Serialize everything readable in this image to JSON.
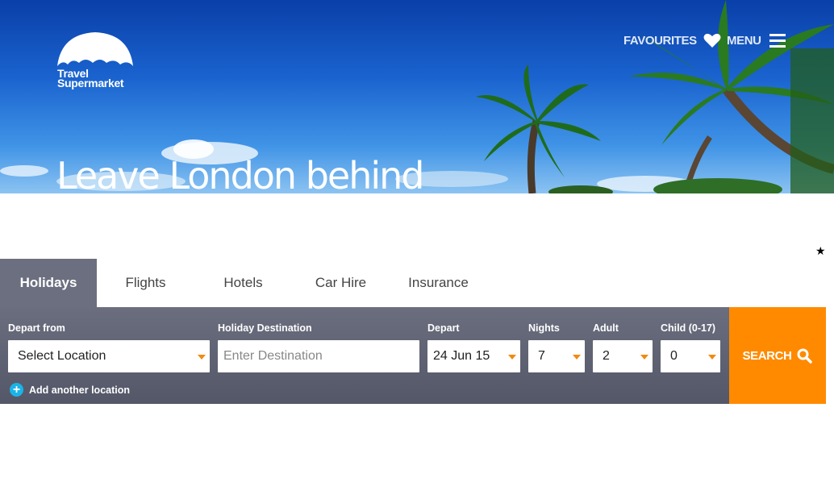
{
  "brand": {
    "logo_line1": "Travel",
    "logo_line2": "Supermarket"
  },
  "nav": {
    "favourites_label": "FAVOURITES",
    "menu_label": "MENU"
  },
  "hero": {
    "title": "Leave London behind"
  },
  "tabs": [
    {
      "label": "Holidays",
      "active": true
    },
    {
      "label": "Flights",
      "active": false
    },
    {
      "label": "Hotels",
      "active": false
    },
    {
      "label": "Car Hire",
      "active": false
    },
    {
      "label": "Insurance",
      "active": false
    }
  ],
  "search": {
    "depart_from": {
      "label": "Depart from",
      "value": "Select Location"
    },
    "destination": {
      "label": "Holiday Destination",
      "placeholder": "Enter Destination"
    },
    "depart": {
      "label": "Depart",
      "value": "24 Jun 15"
    },
    "nights": {
      "label": "Nights",
      "value": "7"
    },
    "adult": {
      "label": "Adult",
      "value": "2"
    },
    "child": {
      "label": "Child (0-17)",
      "value": "0"
    },
    "add_location_label": "Add another location",
    "search_button_label": "SEARCH"
  },
  "colors": {
    "accent": "#ff8a00",
    "panel": "#6b6e7e",
    "caret": "#f08a12",
    "plus": "#1ab4e8"
  }
}
